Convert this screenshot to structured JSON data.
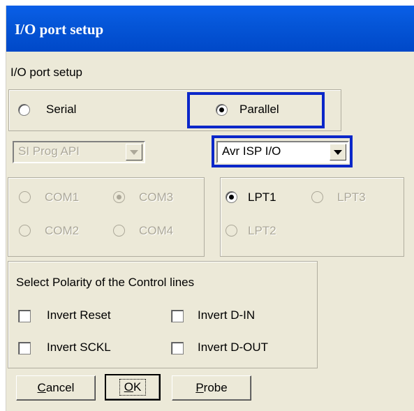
{
  "window": {
    "title": "I/O port setup"
  },
  "dialog": {
    "heading": "I/O port setup"
  },
  "port_type": {
    "serial_label": "Serial",
    "parallel_label": "Parallel",
    "selected": "Parallel"
  },
  "serial_programmer": {
    "value": "SI Prog API",
    "enabled": false
  },
  "parallel_programmer": {
    "value": "Avr ISP I/O",
    "enabled": true
  },
  "com_ports": {
    "com1": "COM1",
    "com2": "COM2",
    "com3": "COM3",
    "com4": "COM4",
    "selected": "COM3",
    "enabled": false
  },
  "lpt_ports": {
    "lpt1": "LPT1",
    "lpt2": "LPT2",
    "lpt3": "LPT3",
    "selected": "LPT1"
  },
  "polarity": {
    "title": "Select Polarity of the Control lines",
    "invert_reset": "Invert Reset",
    "invert_din": "Invert D-IN",
    "invert_sckl": "Invert SCKL",
    "invert_dout": "Invert D-OUT"
  },
  "buttons": {
    "cancel_u": "C",
    "cancel_rest": "ancel",
    "ok_u": "O",
    "ok_rest": "K",
    "probe_u": "P",
    "probe_rest": "robe"
  },
  "highlight_color": "#0b27c9"
}
